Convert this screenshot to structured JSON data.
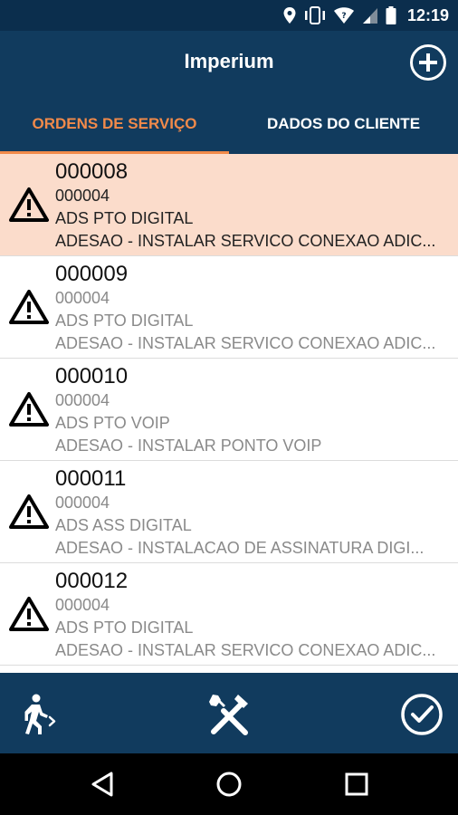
{
  "status_bar": {
    "time": "12:19",
    "icons": [
      "location-icon",
      "vibrate-icon",
      "wifi-icon",
      "signal-icon",
      "battery-icon"
    ]
  },
  "app_bar": {
    "title": "Imperium",
    "add_icon": "plus-circle-icon"
  },
  "tabs": [
    {
      "label": "ORDENS DE SERVIÇO",
      "active": true
    },
    {
      "label": "DADOS DO CLIENTE",
      "active": false
    }
  ],
  "orders": [
    {
      "number": "000008",
      "code": "000004",
      "type": "ADS PTO DIGITAL",
      "description": "ADESAO - INSTALAR SERVICO CONEXAO ADIC...",
      "selected": true
    },
    {
      "number": "000009",
      "code": "000004",
      "type": "ADS PTO DIGITAL",
      "description": "ADESAO - INSTALAR SERVICO CONEXAO ADIC...",
      "selected": false
    },
    {
      "number": "000010",
      "code": "000004",
      "type": "ADS PTO VOIP",
      "description": "ADESAO - INSTALAR PONTO VOIP",
      "selected": false
    },
    {
      "number": "000011",
      "code": "000004",
      "type": "ADS ASS DIGITAL",
      "description": "ADESAO - INSTALACAO DE ASSINATURA DIGI...",
      "selected": false
    },
    {
      "number": "000012",
      "code": "000004",
      "type": "ADS PTO DIGITAL",
      "description": "ADESAO - INSTALAR SERVICO CONEXAO ADIC...",
      "selected": false
    }
  ],
  "bottom_bar": {
    "icons": [
      "walking-person-icon",
      "tools-icon",
      "check-circle-icon"
    ]
  },
  "nav_bar": {
    "icons": [
      "back-icon",
      "home-icon",
      "recents-icon"
    ]
  },
  "colors": {
    "status_bar": "#0b2e4d",
    "primary": "#113b5e",
    "accent": "#f18a4a",
    "selected_row": "#fbdccb"
  }
}
